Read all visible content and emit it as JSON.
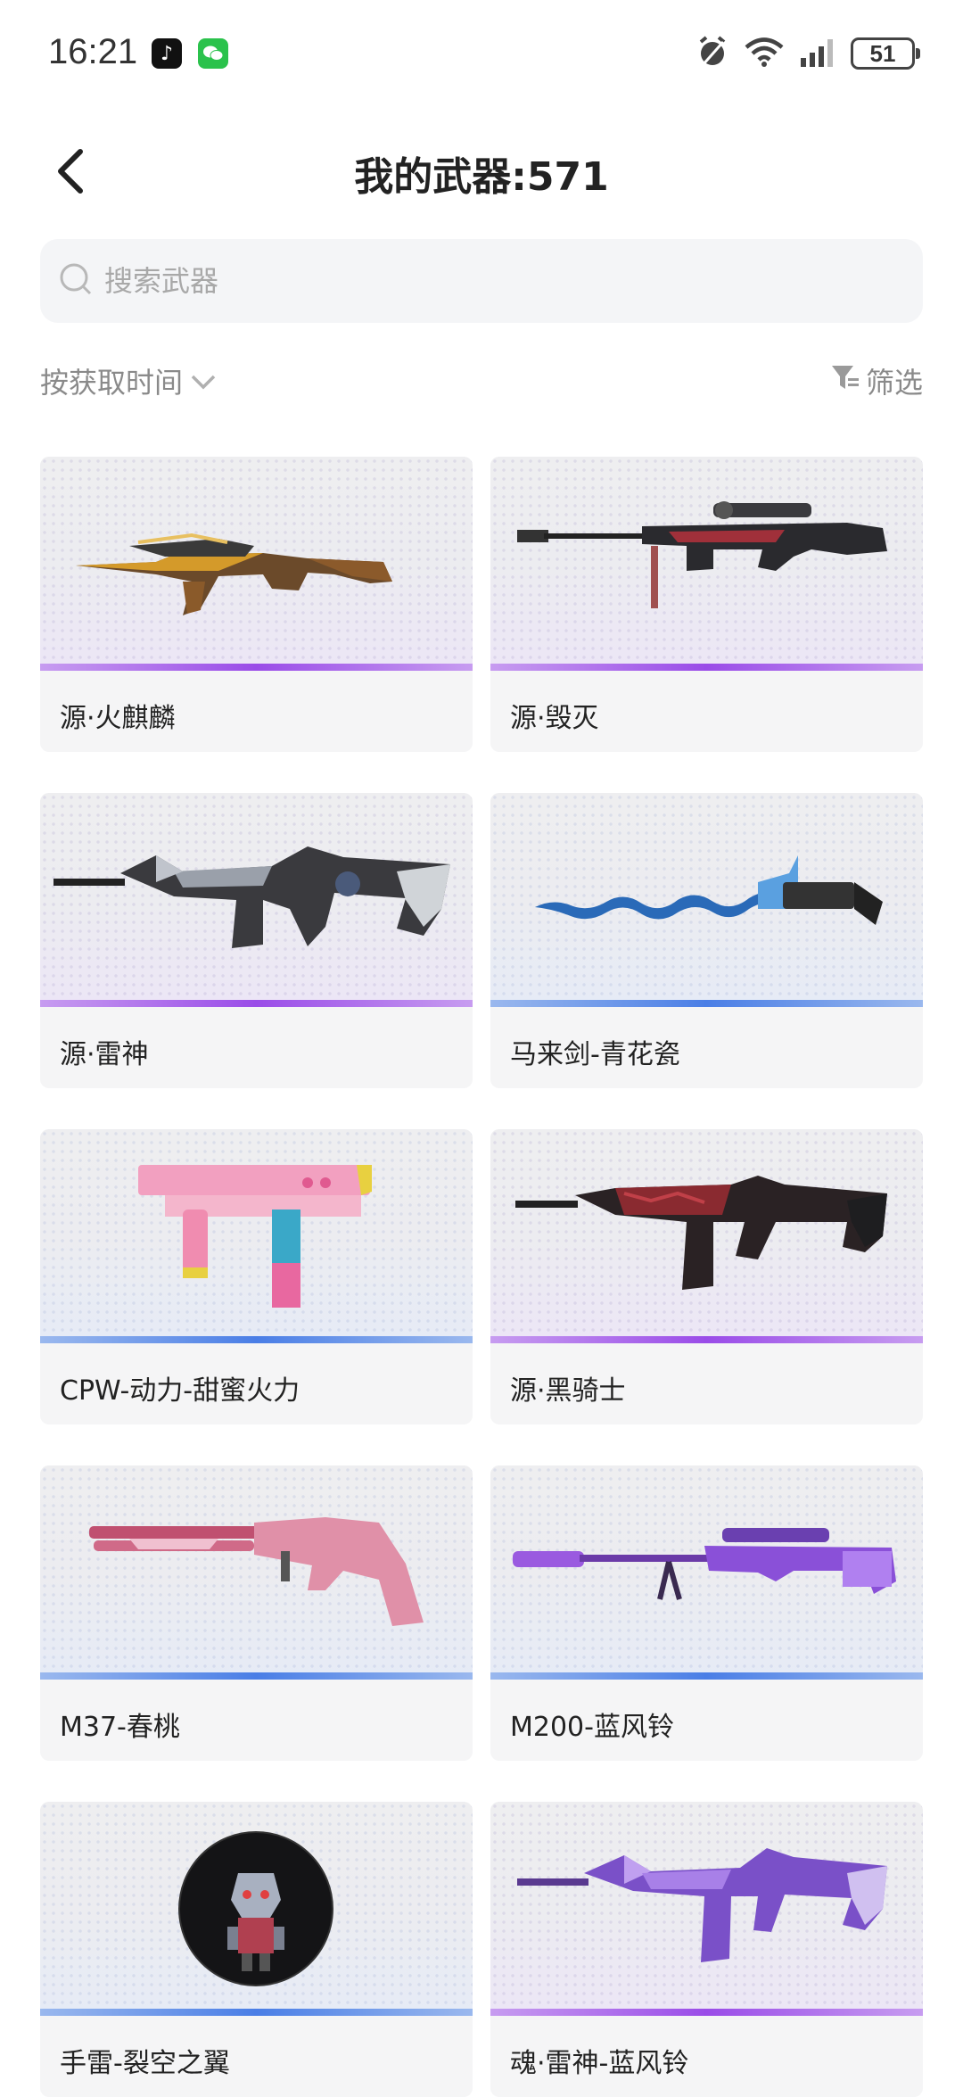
{
  "status": {
    "time": "16:21",
    "battery": "51"
  },
  "header": {
    "title": "我的武器:571"
  },
  "search": {
    "placeholder": "搜索武器"
  },
  "sort": {
    "label": "按获取时间",
    "filter_label": "筛选"
  },
  "colors": {
    "purple": "#9a4ce8",
    "blue": "#4a7ee6",
    "accent_wechat": "#2bc24c"
  },
  "weapons": [
    {
      "name": "源·火麒麟",
      "rarity": "purple",
      "icon": "rifle-gold-icon"
    },
    {
      "name": "源·毁灭",
      "rarity": "purple",
      "icon": "sniper-dark-icon"
    },
    {
      "name": "源·雷神",
      "rarity": "purple",
      "icon": "rifle-silver-icon"
    },
    {
      "name": "马来剑-青花瓷",
      "rarity": "blue",
      "icon": "kris-blade-icon"
    },
    {
      "name": "CPW-动力-甜蜜火力",
      "rarity": "blue",
      "icon": "smg-pink-icon"
    },
    {
      "name": "源·黑骑士",
      "rarity": "purple",
      "icon": "rifle-red-icon"
    },
    {
      "name": "M37-春桃",
      "rarity": "blue",
      "icon": "shotgun-pink-icon"
    },
    {
      "name": "M200-蓝风铃",
      "rarity": "blue",
      "icon": "sniper-purple-icon"
    },
    {
      "name": "手雷-裂空之翼",
      "rarity": "blue",
      "icon": "grenade-icon"
    },
    {
      "name": "魂·雷神-蓝风铃",
      "rarity": "purple",
      "icon": "rifle-purple-icon"
    }
  ]
}
